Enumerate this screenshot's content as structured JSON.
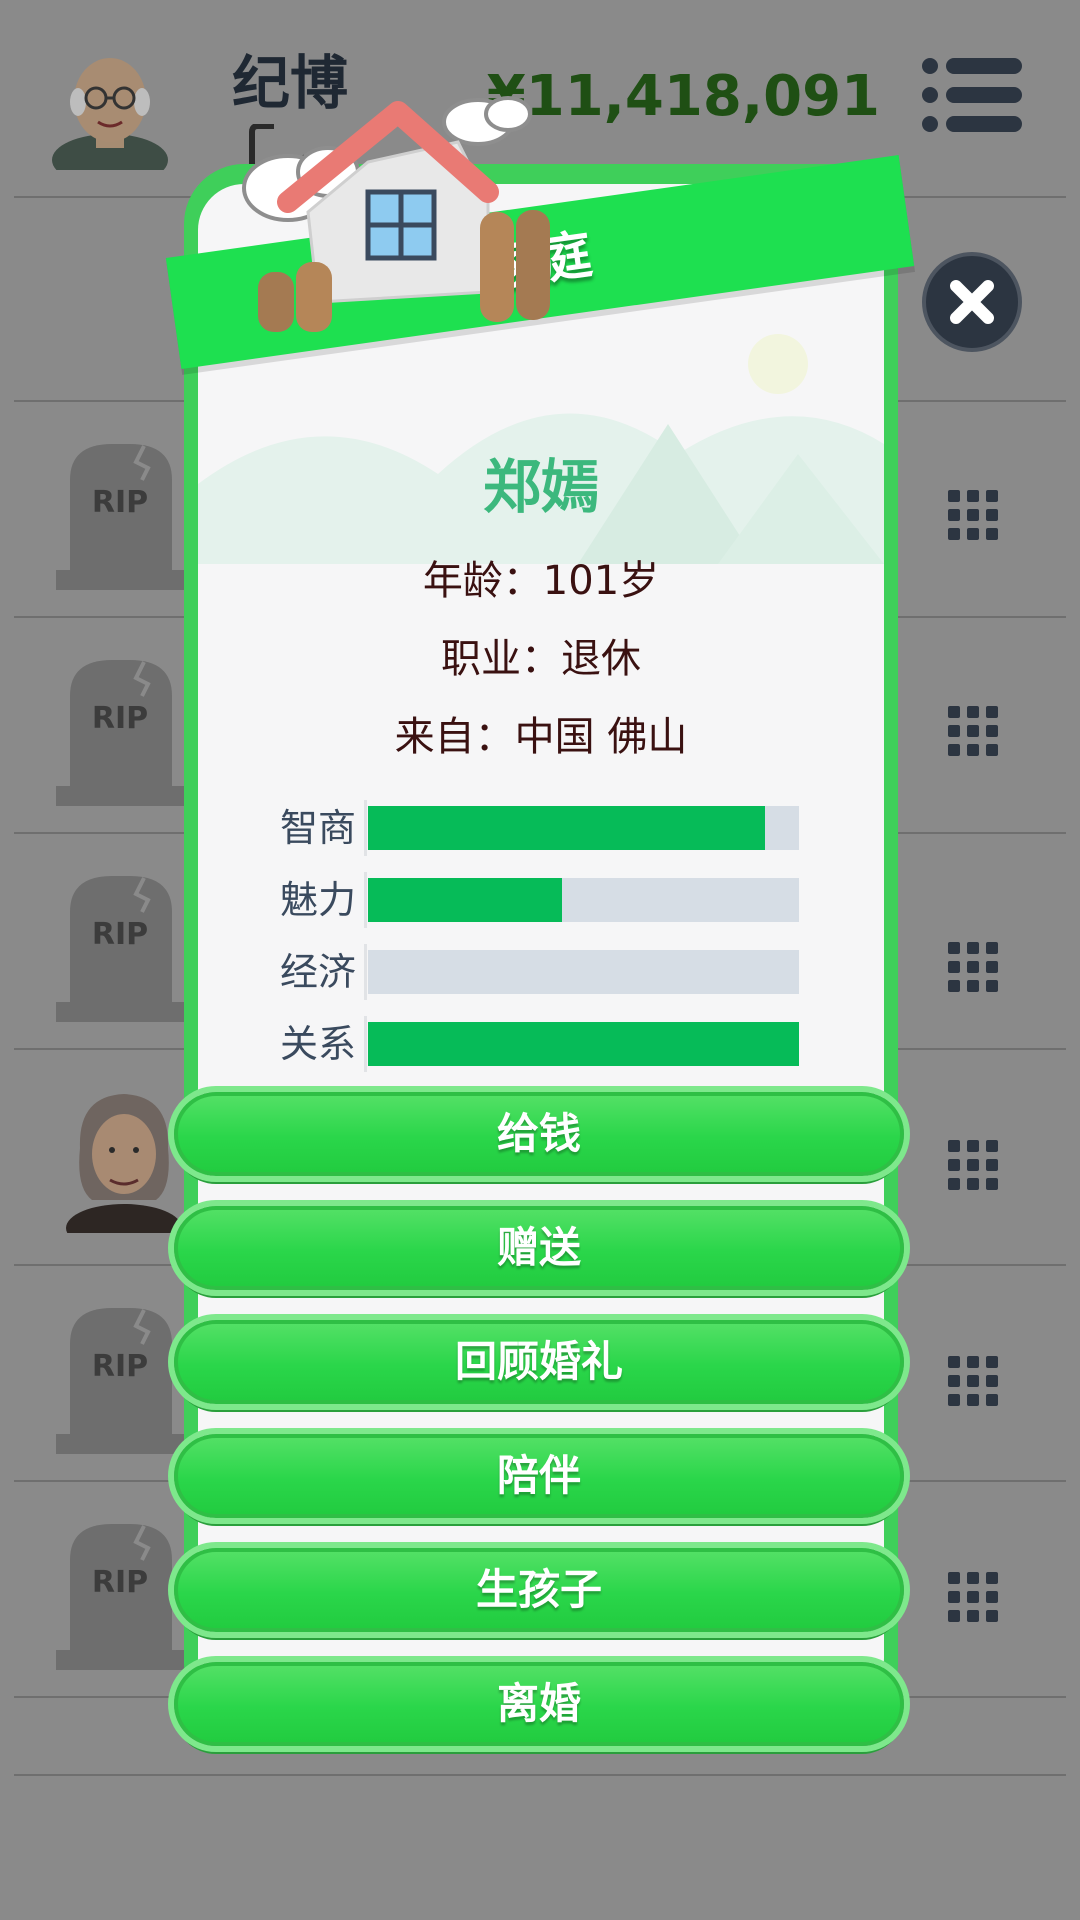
{
  "player": {
    "name": "纪博",
    "job": "退休",
    "money": "¥11,418,091"
  },
  "header": {
    "menu_icon": "hamburger-menu-icon",
    "close_icon": "close-x-icon"
  },
  "family_rows": [
    {
      "type": "tombstone",
      "label": "RIP"
    },
    {
      "type": "tombstone",
      "label": "RIP"
    },
    {
      "type": "tombstone",
      "label": "RIP"
    },
    {
      "type": "portrait",
      "label": ""
    },
    {
      "type": "tombstone",
      "label": "RIP"
    },
    {
      "type": "tombstone",
      "label": "RIP"
    }
  ],
  "dialog": {
    "title": "家庭",
    "person_name": "郑嫣",
    "age_text": "年龄：101岁",
    "job_text": "职业：退休",
    "from_text": "来自：中国 佛山",
    "stats": [
      {
        "label": "智商",
        "value": 0.92
      },
      {
        "label": "魅力",
        "value": 0.45
      },
      {
        "label": "经济",
        "value": 0.0
      },
      {
        "label": "关系",
        "value": 1.0
      }
    ],
    "actions": [
      "给钱",
      "赠送",
      "回顾婚礼",
      "陪伴",
      "生孩子",
      "离婚"
    ]
  },
  "colors": {
    "accent_green": "#1ee050",
    "stat_fill": "#06bb58",
    "name_color": "#3cb87d",
    "money_color": "#1f4f14"
  }
}
